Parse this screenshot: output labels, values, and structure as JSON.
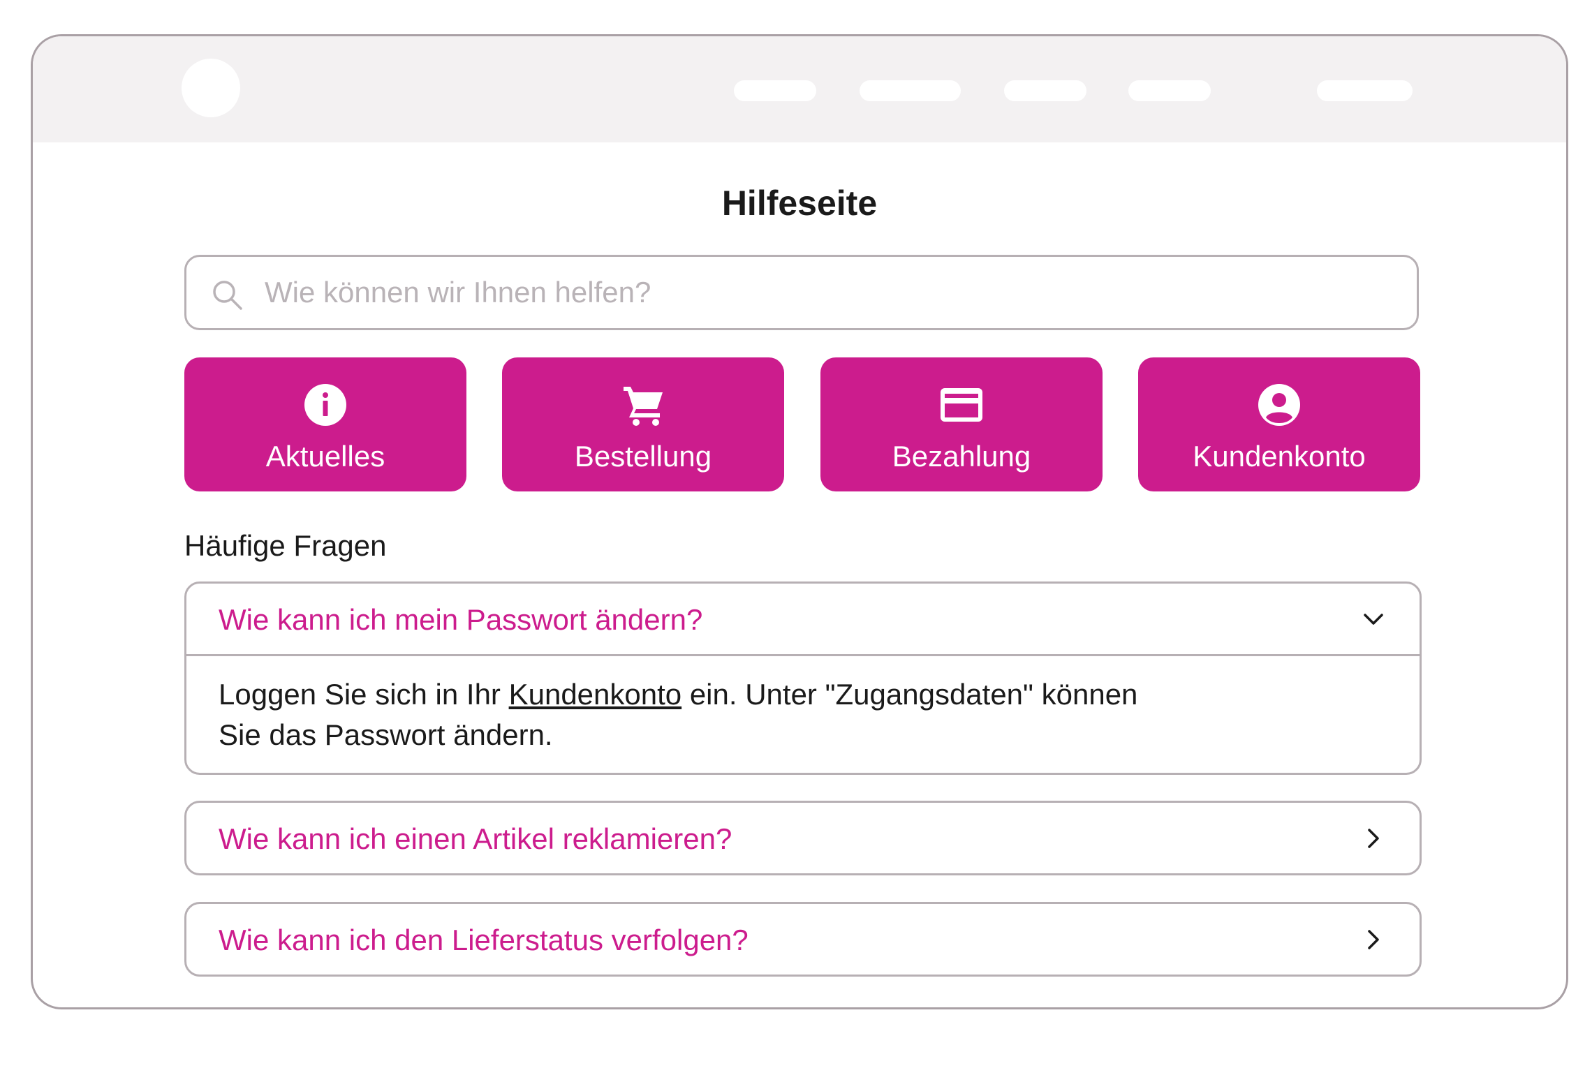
{
  "page": {
    "title": "Hilfeseite"
  },
  "search": {
    "placeholder": "Wie können wir Ihnen helfen?",
    "icon": "search-icon"
  },
  "categories": [
    {
      "label": "Aktuelles",
      "icon": "info-icon"
    },
    {
      "label": "Bestellung",
      "icon": "cart-icon"
    },
    {
      "label": "Bezahlung",
      "icon": "credit-card-icon"
    },
    {
      "label": "Kundenkonto",
      "icon": "account-icon"
    }
  ],
  "faq": {
    "title": "Häufige Fragen",
    "items": [
      {
        "question": "Wie kann ich mein Passwort ändern?",
        "expanded": true,
        "answer_before": "Loggen Sie sich in Ihr ",
        "answer_link": "Kundenkonto",
        "answer_after_line1": " ein. Unter \"Zugangsdaten\" können",
        "answer_line2": "Sie das Passwort ändern."
      },
      {
        "question": "Wie kann ich einen Artikel reklamieren?",
        "expanded": false
      },
      {
        "question": "Wie kann ich den Lieferstatus verfolgen?",
        "expanded": false
      }
    ]
  },
  "colors": {
    "accent": "#cc1c8d",
    "border": "#b7b0b4",
    "topbar": "#f3f1f2",
    "text": "#1a1a1a"
  }
}
